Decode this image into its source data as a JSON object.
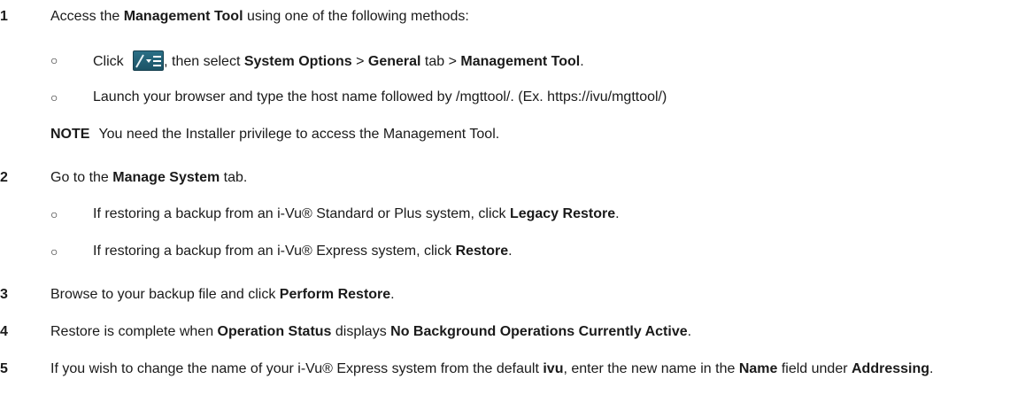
{
  "steps": [
    {
      "num": "1",
      "parts": [
        "Access the ",
        "Management Tool",
        " using one of the following methods:"
      ]
    },
    {
      "num": "2",
      "parts": [
        "Go to the ",
        "Manage System",
        " tab."
      ]
    },
    {
      "num": "3",
      "parts": [
        "Browse to your backup file and click ",
        "Perform Restore",
        "."
      ]
    },
    {
      "num": "4",
      "parts": [
        "Restore is complete when ",
        "Operation Status",
        " displays ",
        "No Background Operations Currently Active",
        "."
      ]
    },
    {
      "num": "5",
      "parts": [
        "If you wish to change the name of your i-Vu® Express system from the default ",
        "ivu",
        ", enter the new name in the ",
        "Name",
        " field under ",
        "Addressing",
        "."
      ]
    }
  ],
  "step1_bullets": {
    "b1": {
      "pre": "Click ",
      "post": ", then select ",
      "opt": "System Options",
      "sep1": " > ",
      "tab": "General",
      "sep2": " tab > ",
      "tool": "Management Tool",
      "end": "."
    },
    "b2": {
      "text": "Launch your browser and type the host name followed by /mgttool/. (Ex. https://ivu/mgttool/)"
    }
  },
  "note": {
    "label": "NOTE",
    "text": "You need the Installer privilege to access the Management Tool."
  },
  "step2_bullets": [
    {
      "pre": "If restoring a backup from an i-Vu® Standard or Plus system, click ",
      "bold": "Legacy Restore",
      "end": "."
    },
    {
      "pre": "If restoring a backup from an i-Vu® Express system, click ",
      "bold": "Restore",
      "end": "."
    }
  ],
  "bullet_glyph": "○",
  "icons": {
    "menu": "menu-icon"
  },
  "colors": {
    "menu_button": "#2a6f86"
  }
}
